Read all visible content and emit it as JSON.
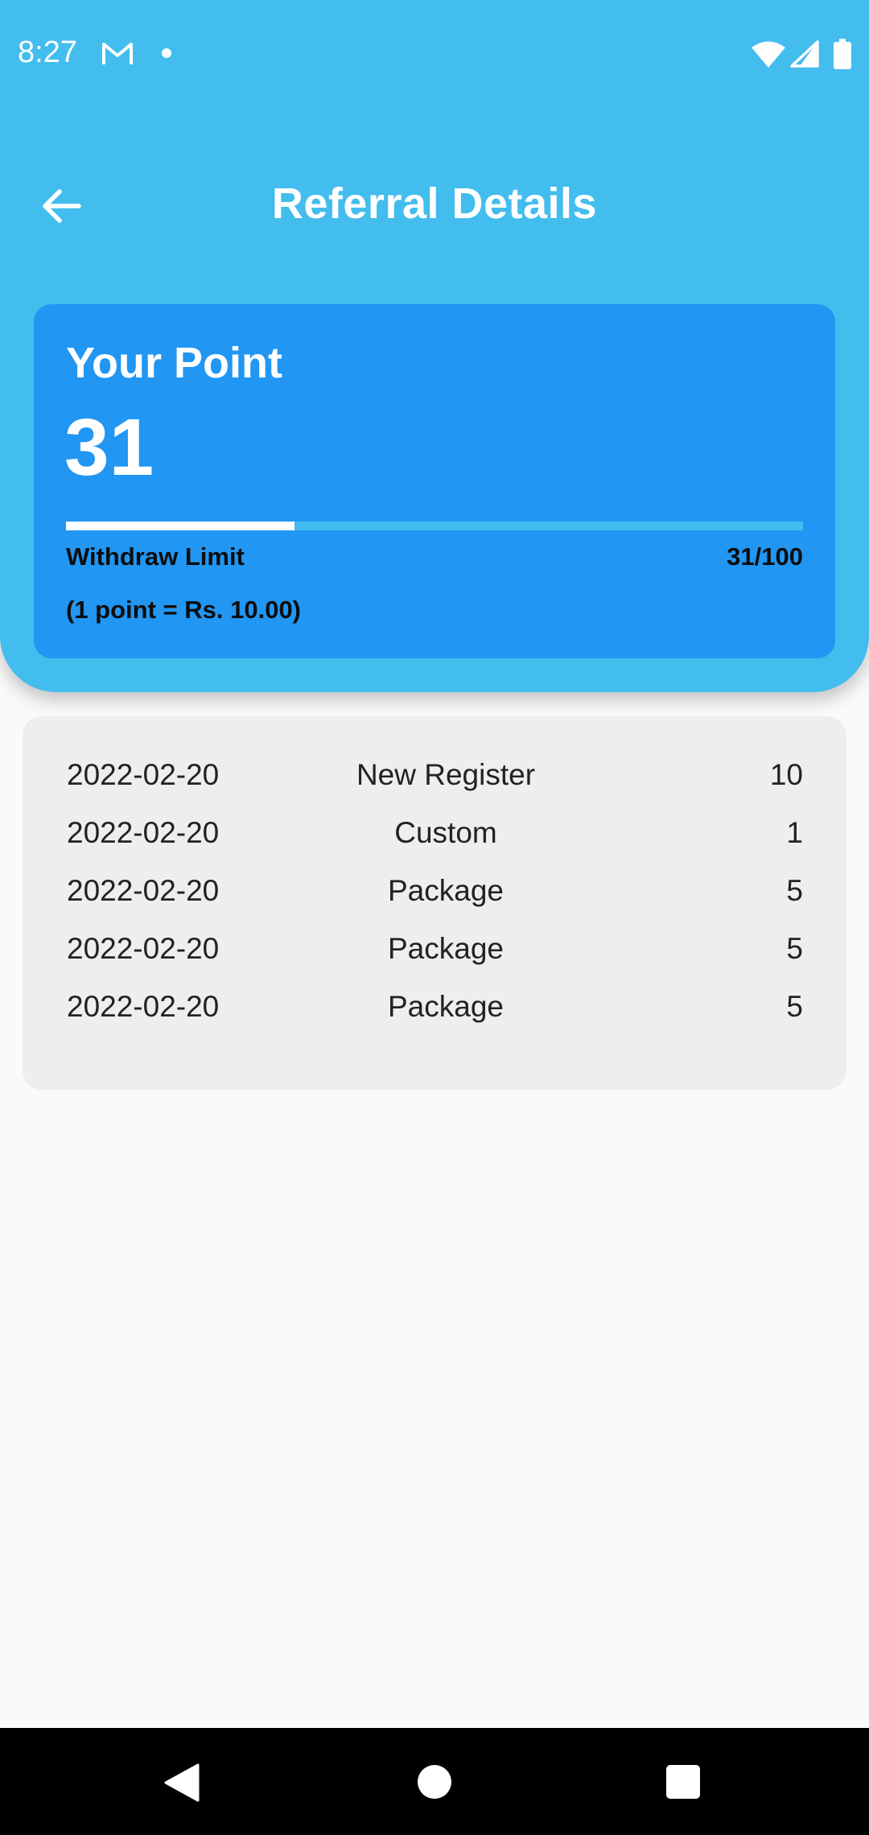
{
  "status_bar": {
    "time": "8:27",
    "icons": [
      "gmail-icon",
      "notification-dot-icon",
      "wifi-icon",
      "signal-icon",
      "battery-icon"
    ]
  },
  "app_bar": {
    "title": "Referral Details",
    "back_icon": "arrow-left-icon"
  },
  "point_card": {
    "heading": "Your Point",
    "value": "31",
    "progress_fraction": 0.31,
    "withdraw_label": "Withdraw Limit",
    "withdraw_count": "31/100",
    "rate_note": "(1 point = Rs. 10.00)"
  },
  "history": [
    {
      "date": "2022-02-20",
      "type": "New Register",
      "points": "10"
    },
    {
      "date": "2022-02-20",
      "type": "Custom",
      "points": "1"
    },
    {
      "date": "2022-02-20",
      "type": "Package",
      "points": "5"
    },
    {
      "date": "2022-02-20",
      "type": "Package",
      "points": "5"
    },
    {
      "date": "2022-02-20",
      "type": "Package",
      "points": "5"
    }
  ],
  "colors": {
    "header_background": "#42bdee",
    "card_background": "#2196f3",
    "history_background": "#eeeeee",
    "page_background": "#fafafa"
  },
  "nav_bar": {
    "icons": [
      "back-triangle-icon",
      "home-circle-icon",
      "recents-square-icon"
    ]
  }
}
